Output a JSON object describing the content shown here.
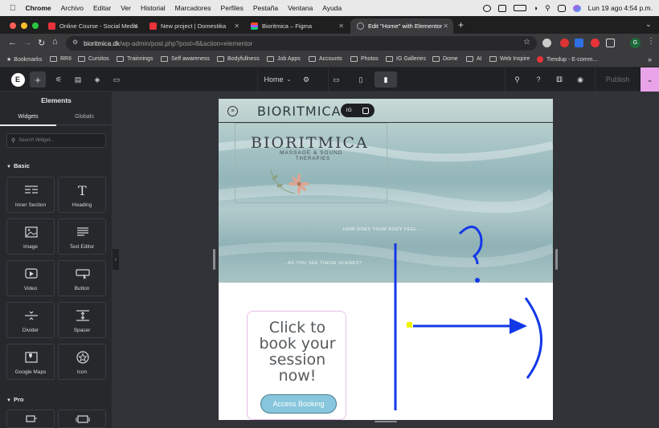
{
  "menubar": {
    "app": "Chrome",
    "items": [
      "Archivo",
      "Editar",
      "Ver",
      "Historial",
      "Marcadores",
      "Perfiles",
      "Pestaña",
      "Ventana",
      "Ayuda"
    ],
    "clock": "Lun 19 ago 4:54 p.m."
  },
  "tabs": [
    {
      "title": "Online Course - Social Media",
      "color": "#e8333a"
    },
    {
      "title": "New project | Domestika",
      "color": "#e8333a"
    },
    {
      "title": "Bioritmica – Figma",
      "color": "#a259ff"
    },
    {
      "title": "Edit \"Home\" with Elementor",
      "color": "#888888"
    }
  ],
  "address": {
    "domain": "bioritmica.dk",
    "path": "/wp-admin/post.php?post=8&action=elementor"
  },
  "bookmarks": [
    "Bookmarks",
    "RRII",
    "Cursitos",
    "Trainnings",
    "Self awareness",
    "Bodyfullness",
    "Job Apps",
    "Accounts",
    "Photos",
    "IG Galleries",
    "Dome",
    "AI",
    "Web Inspire",
    "Tiendup - E-comm..."
  ],
  "editor": {
    "page_name": "Home",
    "publish": "Publish"
  },
  "panel": {
    "title": "Elements",
    "tabs": [
      "Widgets",
      "Globals"
    ],
    "search_placeholder": "Search Widget...",
    "section_basic": "Basic",
    "section_pro": "Pro",
    "widgets": [
      "Inner Section",
      "Heading",
      "Image",
      "Text Editor",
      "Video",
      "Button",
      "Divider",
      "Spacer",
      "Google Maps",
      "Icon"
    ]
  },
  "site": {
    "header_logo": "BIORITMICA",
    "social_ig": "IG",
    "hero_logo": "BIORITMICA",
    "hero_tagline": "MASSAGE & SOUND",
    "hero_tagline2": "THERAPIES",
    "question1": "HOW DOES YOUR BODY FEEL...",
    "question2": "...AS YOU SEE THESE SCENES?",
    "cta_text": "Click to book your session now!",
    "cta_button": "Access Booking"
  },
  "annotation": {
    "question_mark": "?",
    "color": "#1338e8"
  }
}
